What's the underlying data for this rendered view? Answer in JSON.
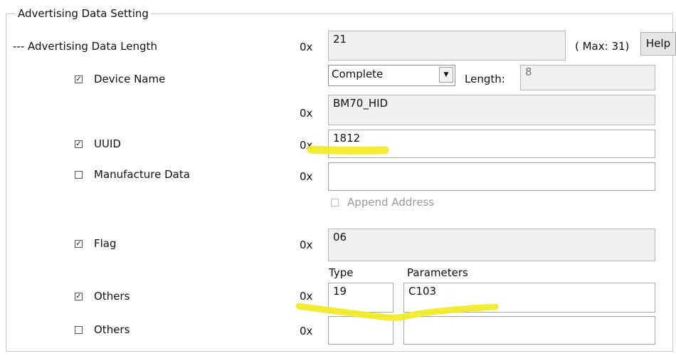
{
  "group_title": "Advertising Data Setting",
  "prefix": "0x",
  "adv_length": {
    "label": "--- Advertising Data Length",
    "value": "21",
    "max_text": "( Max: 31)",
    "help_label": "Help"
  },
  "device_name": {
    "checkbox_label": "Device Name",
    "checked": true,
    "mode_selected": "Complete",
    "length_label": "Length:",
    "length_value": "8",
    "value": "BM70_HID"
  },
  "uuid": {
    "checkbox_label": "UUID",
    "checked": true,
    "value": "1812"
  },
  "manufacture_data": {
    "checkbox_label": "Manufacture Data",
    "checked": false,
    "value": "",
    "append_address_label": "Append Address",
    "append_address_checked": false
  },
  "flag": {
    "checkbox_label": "Flag",
    "checked": true,
    "value": "06"
  },
  "others_headers": {
    "type": "Type",
    "parameters": "Parameters"
  },
  "others": [
    {
      "checkbox_label": "Others",
      "checked": true,
      "type": "19",
      "parameters": "C103"
    },
    {
      "checkbox_label": "Others",
      "checked": false,
      "type": "",
      "parameters": ""
    }
  ],
  "highlight_color": "#f2ea1e"
}
